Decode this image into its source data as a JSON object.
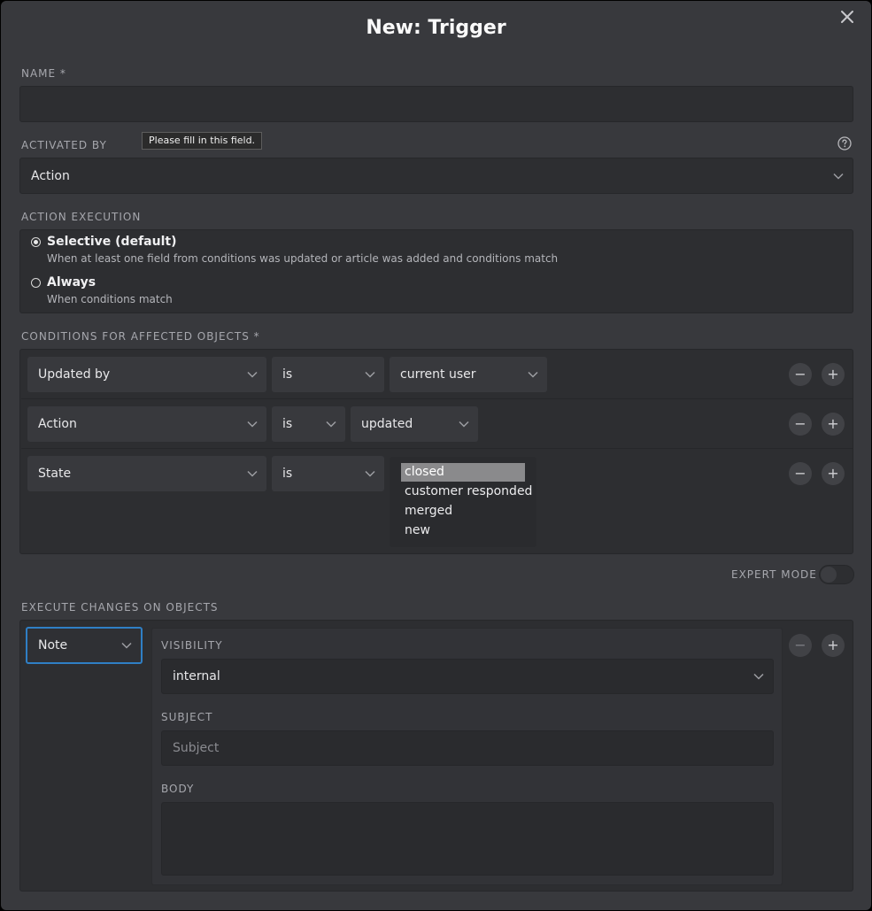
{
  "dialog": {
    "title": "New: Trigger",
    "close_icon": "close-icon"
  },
  "name": {
    "label": "NAME *",
    "value": "",
    "tooltip": "Please fill in this field."
  },
  "activated_by": {
    "label": "ACTIVATED BY",
    "value": "Action",
    "help_icon": "help-circle-icon"
  },
  "action_execution": {
    "label": "ACTION EXECUTION",
    "options": [
      {
        "title": "Selective (default)",
        "description": "When at least one field from conditions was updated or article was added and conditions match",
        "selected": true
      },
      {
        "title": "Always",
        "description": "When conditions match",
        "selected": false
      }
    ]
  },
  "conditions": {
    "label": "CONDITIONS FOR AFFECTED OBJECTS *",
    "rows": [
      {
        "attribute": "Updated by",
        "operator": "is",
        "value": "current user"
      },
      {
        "attribute": "Action",
        "operator": "is",
        "value": "updated"
      },
      {
        "attribute": "State",
        "operator": "is",
        "options": [
          "closed",
          "customer responded",
          "merged",
          "new"
        ],
        "selected": "closed"
      }
    ],
    "remove_symbol": "−",
    "add_symbol": "+"
  },
  "expert_mode": {
    "label": "EXPERT MODE",
    "enabled": false
  },
  "execute_changes": {
    "label": "EXECUTE CHANGES ON OBJECTS",
    "type": "Note",
    "visibility_label": "VISIBILITY",
    "visibility_value": "internal",
    "subject_label": "SUBJECT",
    "subject_placeholder": "Subject",
    "body_label": "BODY",
    "body_value": ""
  },
  "colors": {
    "background": "#38393d",
    "field": "#2d2e31",
    "focus_border": "#2f7fc5",
    "selected_option": "#8a8a8c"
  }
}
